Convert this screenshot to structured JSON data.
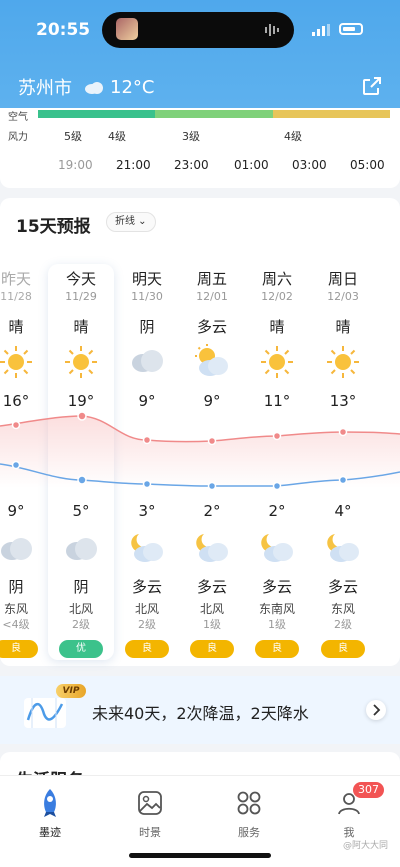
{
  "status_bar": {
    "time": "20:55"
  },
  "header": {
    "city": "苏州市",
    "temperature": "12°C"
  },
  "hourly": {
    "row_labels": [
      "空气",
      "风力"
    ],
    "wind_levels": [
      "5级",
      "4级",
      "3级",
      "4级"
    ],
    "hours": [
      "19:00",
      "21:00",
      "23:00",
      "01:00",
      "03:00",
      "05:00"
    ]
  },
  "forecast": {
    "title": "15天预报",
    "view_toggle": "折线",
    "days": [
      {
        "name": "昨天",
        "date": "11/28",
        "cond_day": "晴",
        "icon_day": "sun-icon",
        "high": "16°",
        "low": "9°",
        "icon_night": "cloud-icon",
        "cond_night": "阴",
        "wind": "东风",
        "level": "<4级",
        "aqi": "良"
      },
      {
        "name": "今天",
        "date": "11/29",
        "cond_day": "晴",
        "icon_day": "sun-icon",
        "high": "19°",
        "low": "5°",
        "icon_night": "cloud-icon",
        "cond_night": "阴",
        "wind": "北风",
        "level": "2级",
        "aqi": "优"
      },
      {
        "name": "明天",
        "date": "11/30",
        "cond_day": "阴",
        "icon_day": "cloud-icon",
        "high": "9°",
        "low": "3°",
        "icon_night": "moon-cloud-icon",
        "cond_night": "多云",
        "wind": "北风",
        "level": "2级",
        "aqi": "良"
      },
      {
        "name": "周五",
        "date": "12/01",
        "cond_day": "多云",
        "icon_day": "sun-cloud-icon",
        "high": "9°",
        "low": "2°",
        "icon_night": "moon-cloud-icon",
        "cond_night": "多云",
        "wind": "北风",
        "level": "1级",
        "aqi": "良"
      },
      {
        "name": "周六",
        "date": "12/02",
        "cond_day": "晴",
        "icon_day": "sun-icon",
        "high": "11°",
        "low": "2°",
        "icon_night": "moon-cloud-icon",
        "cond_night": "多云",
        "wind": "东南风",
        "level": "1级",
        "aqi": "良"
      },
      {
        "name": "周日",
        "date": "12/03",
        "cond_day": "晴",
        "icon_day": "sun-icon",
        "high": "13°",
        "low": "4°",
        "icon_night": "moon-cloud-icon",
        "cond_night": "多云",
        "wind": "东风",
        "level": "2级",
        "aqi": "良"
      }
    ]
  },
  "vip": {
    "badge": "VIP",
    "text": "未来40天，2次降温，2天降水"
  },
  "life": {
    "title": "生活服务"
  },
  "tabs": [
    {
      "label": "墨迹",
      "icon": "rocket-icon"
    },
    {
      "label": "时景",
      "icon": "picture-icon"
    },
    {
      "label": "服务",
      "icon": "grid-icon"
    },
    {
      "label": "我",
      "icon": "profile-icon",
      "badge": "307"
    }
  ],
  "colors": {
    "header": "#4fa8ec",
    "high_line": "#f08a8a",
    "low_line": "#6aa6e6",
    "aqi_good": "#3cc28b",
    "aqi_fair": "#f3b500"
  },
  "watermark": "@阿大大同"
}
